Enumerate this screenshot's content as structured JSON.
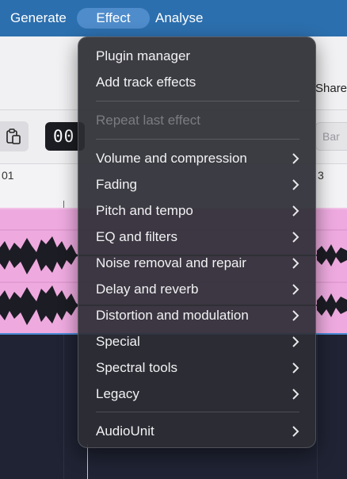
{
  "menubar": {
    "generate": "Generate",
    "effect": "Effect",
    "analyse": "Analyse"
  },
  "toolbar": {
    "share_label": "Share",
    "time_display": "00",
    "bar_placeholder": "Bar"
  },
  "ruler": {
    "label_left": "01",
    "label_right": "3"
  },
  "effect_menu": {
    "plugin_manager": "Plugin manager",
    "add_track_effects": "Add track effects",
    "repeat_last_effect": "Repeat last effect",
    "volume_and_compression": "Volume and compression",
    "fading": "Fading",
    "pitch_and_tempo": "Pitch and tempo",
    "eq_and_filters": "EQ and filters",
    "noise_removal_and_repair": "Noise removal and repair",
    "delay_and_reverb": "Delay and reverb",
    "distortion_and_modulation": "Distortion and modulation",
    "special": "Special",
    "spectral_tools": "Spectral tools",
    "legacy": "Legacy",
    "audiounit": "AudioUnit"
  },
  "colors": {
    "menubar": "#2c6fae",
    "menubar_active": "#4f8ccb",
    "track_clip": "#eeaadf",
    "waveform": "#1c1c24",
    "menu_background": "#2c2e34"
  }
}
